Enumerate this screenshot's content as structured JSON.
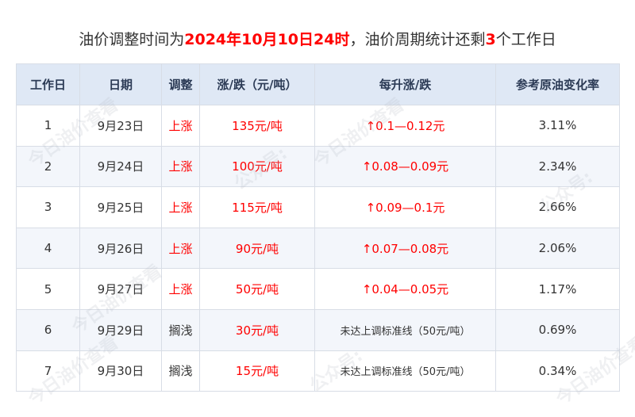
{
  "title": {
    "prefix": "油价调整时间为",
    "highlight_time": "2024年10月10日24时",
    "middle": "，油价周期统计还剩",
    "highlight_count": "3",
    "suffix": "个工作日"
  },
  "table": {
    "headers": [
      "工作日",
      "日期",
      "调整",
      "涨/跌（元/吨）",
      "每升涨/跌",
      "参考原油变化率"
    ],
    "rows": [
      {
        "day": "1",
        "date": "9月23日",
        "adjust": "上涨",
        "ton": "135元/吨",
        "liter": "↑0.1—0.12元",
        "rate": "3.11%"
      },
      {
        "day": "2",
        "date": "9月24日",
        "adjust": "上涨",
        "ton": "100元/吨",
        "liter": "↑0.08—0.09元",
        "rate": "2.34%"
      },
      {
        "day": "3",
        "date": "9月25日",
        "adjust": "上涨",
        "ton": "115元/吨",
        "liter": "↑0.09—0.1元",
        "rate": "2.66%"
      },
      {
        "day": "4",
        "date": "9月26日",
        "adjust": "上涨",
        "ton": "90元/吨",
        "liter": "↑0.07—0.08元",
        "rate": "2.06%"
      },
      {
        "day": "5",
        "date": "9月27日",
        "adjust": "上涨",
        "ton": "50元/吨",
        "liter": "↑0.04—0.05元",
        "rate": "1.17%"
      },
      {
        "day": "6",
        "date": "9月29日",
        "adjust": "搁浅",
        "ton": "30元/吨",
        "liter": "未达上调标准线（50元/吨）",
        "rate": "0.69%"
      },
      {
        "day": "7",
        "date": "9月30日",
        "adjust": "搁浅",
        "ton": "15元/吨",
        "liter": "未达上调标准线（50元/吨）",
        "rate": "0.34%"
      }
    ]
  },
  "watermarks": [
    "今日油价查看",
    "公众号:"
  ],
  "colors": {
    "highlight": "#ff0000",
    "header_bg": "#dfe8f5",
    "stripe_bg": "#f3f6fb",
    "border": "#d8dde6"
  }
}
